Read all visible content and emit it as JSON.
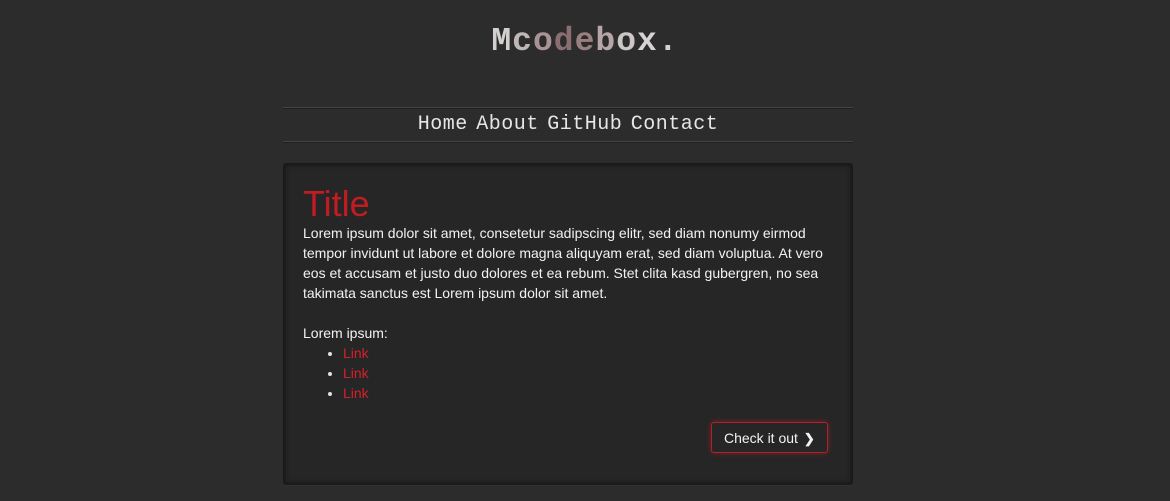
{
  "site": {
    "logo_letters": [
      "M",
      "c",
      "o",
      "d",
      "e",
      "b",
      "o",
      "x",
      "."
    ]
  },
  "nav": {
    "items": [
      "Home",
      "About",
      "GitHub",
      "Contact"
    ]
  },
  "panel": {
    "title": "Title",
    "body": "Lorem ipsum dolor sit amet, consetetur sadipscing elitr, sed diam nonumy eirmod tempor invidunt ut labore et dolore magna aliquyam erat, sed diam voluptua. At vero eos et accusam et justo duo dolores et ea rebum. Stet clita kasd gubergren, no sea takimata sanctus est Lorem ipsum dolor sit amet.",
    "list_label": "Lorem ipsum:",
    "links": [
      "Link",
      "Link",
      "Link"
    ],
    "button_label": "Check it out",
    "button_icon": "chevron-right-icon"
  },
  "colors": {
    "background": "#2c2c2c",
    "panel": "#262626",
    "accent": "#c01c22",
    "text": "#f2f2f2"
  }
}
